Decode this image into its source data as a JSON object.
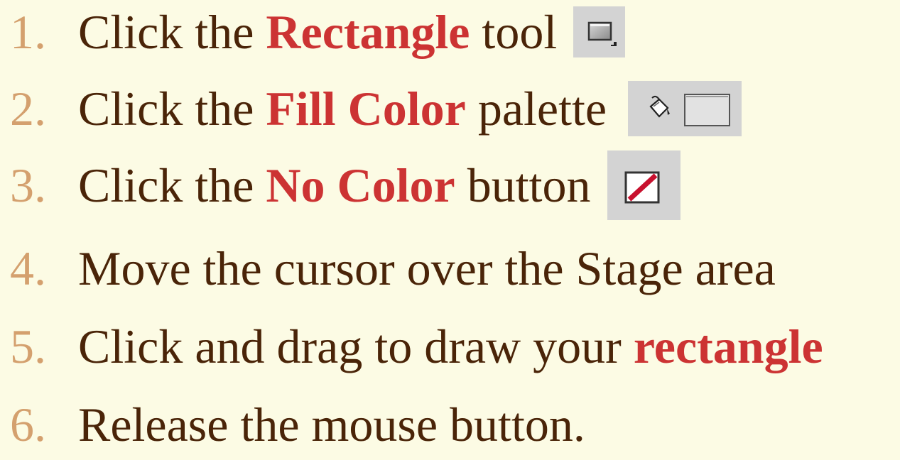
{
  "steps": [
    {
      "number": "1.",
      "prefix": "Click the ",
      "highlight": "Rectangle",
      "suffix": " tool",
      "icon": "rectangle-tool-icon"
    },
    {
      "number": "2.",
      "prefix": "Click the ",
      "highlight": "Fill Color",
      "suffix": " palette",
      "icon": "fill-color-icon"
    },
    {
      "number": "3.",
      "prefix": "Click the ",
      "highlight": "No Color",
      "suffix": " button",
      "icon": "no-color-icon"
    },
    {
      "number": "4.",
      "text": "Move the cursor over the Stage area"
    },
    {
      "number": "5.",
      "prefix": "Click and drag to draw your ",
      "highlight": "rectangle"
    },
    {
      "number": "6.",
      "text": "Release the mouse button."
    }
  ],
  "colors": {
    "background": "#fcfbe4",
    "number": "#d4a06e",
    "text": "#4a2408",
    "highlight": "#cc3333",
    "icon_background": "#d3d3d3"
  }
}
